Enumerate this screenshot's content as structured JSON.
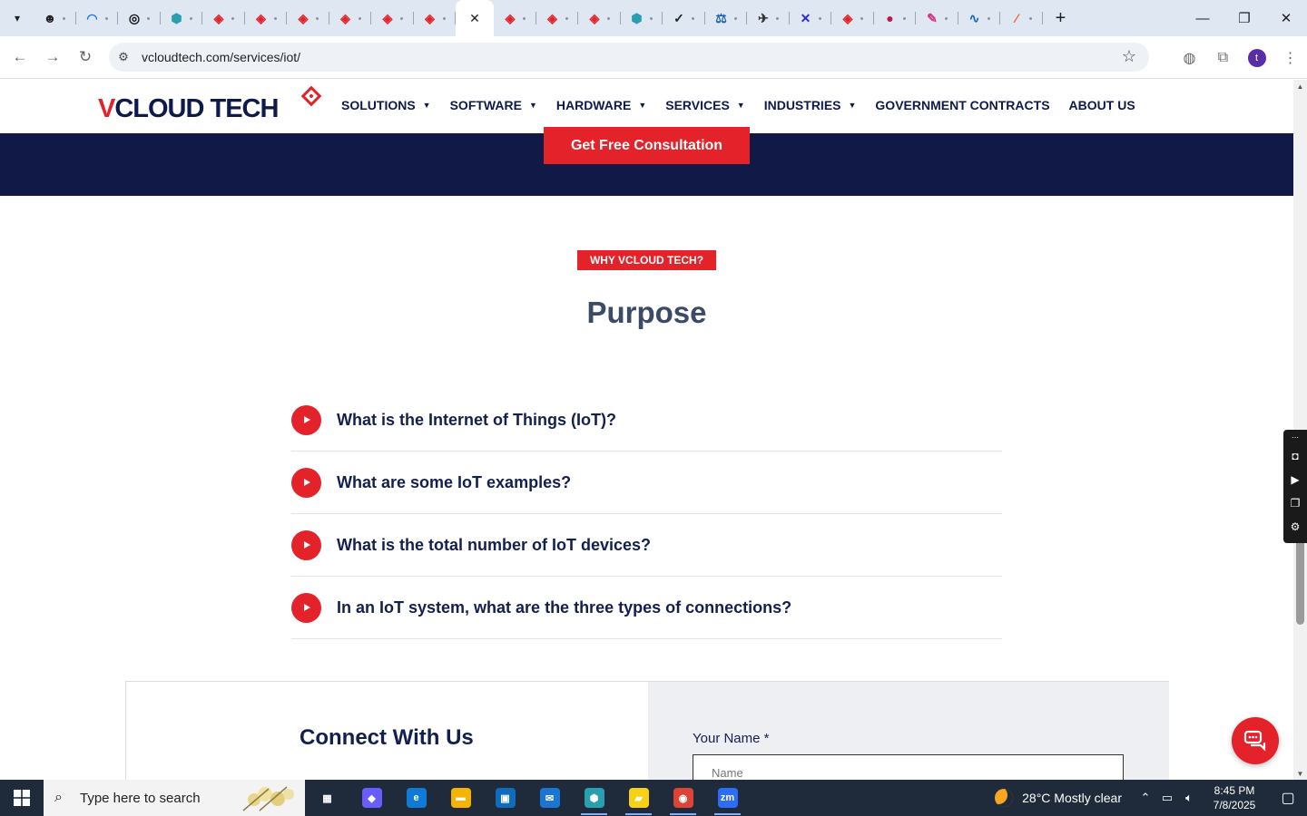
{
  "browser": {
    "tabs": [
      {
        "icon": "ghost-icon",
        "color": "#222222",
        "glyph": "☻"
      },
      {
        "icon": "wave-icon",
        "color": "#1a73e8",
        "glyph": "◠"
      },
      {
        "icon": "openai-icon",
        "color": "#111111",
        "glyph": "◎"
      },
      {
        "icon": "hex-icon",
        "color": "#2a9fb0",
        "glyph": "⬢"
      },
      {
        "icon": "vcloud-icon",
        "color": "#e3222a",
        "glyph": "◈"
      },
      {
        "icon": "vcloud-icon",
        "color": "#e3222a",
        "glyph": "◈"
      },
      {
        "icon": "vcloud-icon",
        "color": "#e3222a",
        "glyph": "◈"
      },
      {
        "icon": "vcloud-icon",
        "color": "#e3222a",
        "glyph": "◈"
      },
      {
        "icon": "vcloud-icon",
        "color": "#e3222a",
        "glyph": "◈"
      },
      {
        "icon": "vcloud-icon",
        "color": "#e3222a",
        "glyph": "◈"
      },
      {
        "icon": "vcloud-icon",
        "color": "#e3222a",
        "glyph": "◈"
      },
      {
        "icon": "vcloud-icon",
        "color": "#e3222a",
        "glyph": "◈"
      },
      {
        "icon": "vcloud-icon",
        "color": "#e3222a",
        "glyph": "◈"
      },
      {
        "icon": "vcloud-icon",
        "color": "#e3222a",
        "glyph": "◈"
      },
      {
        "icon": "hex-icon",
        "color": "#2a9fb0",
        "glyph": "⬢"
      },
      {
        "icon": "check-icon",
        "color": "#222222",
        "glyph": "✓"
      },
      {
        "icon": "scale-icon",
        "color": "#1a5fb4",
        "glyph": "⚖"
      },
      {
        "icon": "plane-icon",
        "color": "#333333",
        "glyph": "✈"
      },
      {
        "icon": "x-icon",
        "color": "#2b2bd6",
        "glyph": "✕"
      },
      {
        "icon": "vcloud-icon",
        "color": "#e3222a",
        "glyph": "◈"
      },
      {
        "icon": "ball-icon",
        "color": "#c0184a",
        "glyph": "●"
      },
      {
        "icon": "pen-icon",
        "color": "#d63384",
        "glyph": "✎"
      },
      {
        "icon": "pulse-icon",
        "color": "#1565c0",
        "glyph": "∿"
      },
      {
        "icon": "swoosh-icon",
        "color": "#ef5b25",
        "glyph": "⁄"
      }
    ],
    "active_tab_index": 10,
    "url": "vcloudtech.com/services/iot/"
  },
  "site": {
    "logo_text": "VCLOUD TECH",
    "nav": [
      {
        "label": "SOLUTIONS",
        "caret": true
      },
      {
        "label": "SOFTWARE",
        "caret": true
      },
      {
        "label": "HARDWARE",
        "caret": true
      },
      {
        "label": "SERVICES",
        "caret": true
      },
      {
        "label": "INDUSTRIES",
        "caret": true
      },
      {
        "label": "GOVERNMENT CONTRACTS",
        "caret": false
      },
      {
        "label": "ABOUT US",
        "caret": false
      }
    ],
    "cta_label": "Get Free Consultation",
    "section_tag": "WHY VCLOUD TECH?",
    "section_title": "Purpose",
    "faq": [
      "What is the Internet of Things (IoT)?",
      "What are some IoT examples?",
      "What is the total number of IoT devices?",
      "In an IoT system, what are the three types of connections?"
    ],
    "connect": {
      "title": "Connect With Us",
      "name_label": "Your Name *",
      "name_placeholder": "Name"
    },
    "colors": {
      "brand_red": "#e3222a",
      "navy": "#111a46",
      "text_navy": "#13204f"
    }
  },
  "taskbar": {
    "search_placeholder": "Type here to search",
    "weather": "28°C  Mostly clear",
    "time": "8:45 PM",
    "date": "7/8/2025",
    "apps": [
      {
        "name": "task-view",
        "color": "#1f2b3a",
        "glyph": "▦",
        "running": false
      },
      {
        "name": "copilot",
        "color": "#6a5cff",
        "glyph": "◆",
        "running": false
      },
      {
        "name": "edge",
        "color": "#0f7bd6",
        "glyph": "e",
        "running": false
      },
      {
        "name": "file-explorer",
        "color": "#f4b400",
        "glyph": "▬",
        "running": false
      },
      {
        "name": "store",
        "color": "#0f6cbd",
        "glyph": "▣",
        "running": false
      },
      {
        "name": "mail",
        "color": "#1976d2",
        "glyph": "✉",
        "running": false
      },
      {
        "name": "hex-app",
        "color": "#2a9fb0",
        "glyph": "⬢",
        "running": true
      },
      {
        "name": "sticky-notes",
        "color": "#f7d116",
        "glyph": "▰",
        "running": true
      },
      {
        "name": "chrome",
        "color": "#db4437",
        "glyph": "◉",
        "running": true
      },
      {
        "name": "zoom",
        "color": "#2d6cf6",
        "glyph": "zm",
        "running": true
      }
    ]
  }
}
